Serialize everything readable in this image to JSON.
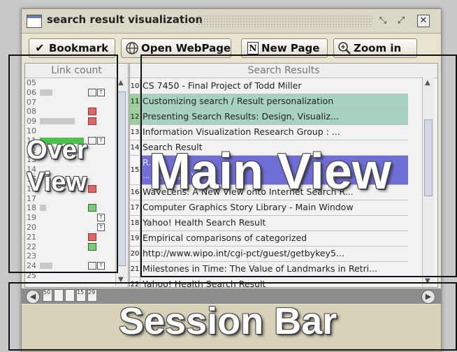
{
  "window": {
    "title": "search result visualization",
    "controls": {
      "minimize_icon": "minimize-icon",
      "maximize_icon": "maximize-icon",
      "close_label": "✕"
    }
  },
  "toolbar": {
    "bookmark_label": "Bookmark",
    "open_webpage_label": "Open WebPage",
    "new_page_label": "New Page",
    "zoom_in_label": "Zoom in",
    "new_page_icon_letter": "N"
  },
  "overview": {
    "header": "Link count",
    "rows": [
      {
        "num": "05",
        "bar": 0,
        "i1": "",
        "i2": ""
      },
      {
        "num": "06",
        "bar": 0.2,
        "i1": "grey",
        "i2": "T"
      },
      {
        "num": "07",
        "bar": 0,
        "i1": "",
        "i2": ""
      },
      {
        "num": "08",
        "bar": 0,
        "i1": "red",
        "i2": ""
      },
      {
        "num": "09",
        "bar": 0.55,
        "i1": "red",
        "i2": ""
      },
      {
        "num": "10",
        "bar": 0,
        "i1": "",
        "i2": ""
      },
      {
        "num": "11",
        "bar": 0.7,
        "i1": "grey",
        "i2": "T",
        "green": true
      },
      {
        "num": "12",
        "bar": 0,
        "i1": "",
        "i2": ""
      },
      {
        "num": "13",
        "bar": 0,
        "i1": "",
        "i2": ""
      },
      {
        "num": "14",
        "bar": 0,
        "i1": "",
        "i2": ""
      },
      {
        "num": "15",
        "bar": 0,
        "i1": "",
        "i2": ""
      },
      {
        "num": "16",
        "bar": 0,
        "i1": "red",
        "i2": ""
      },
      {
        "num": "17",
        "bar": 0,
        "i1": "",
        "i2": ""
      },
      {
        "num": "18",
        "bar": 0.1,
        "i1": "grn",
        "i2": ""
      },
      {
        "num": "19",
        "bar": 0,
        "i1": "",
        "i2": "T"
      },
      {
        "num": "20",
        "bar": 0,
        "i1": "",
        "i2": "T"
      },
      {
        "num": "21",
        "bar": 0,
        "i1": "red",
        "i2": ""
      },
      {
        "num": "22",
        "bar": 0,
        "i1": "grn",
        "i2": ""
      },
      {
        "num": "23",
        "bar": 0,
        "i1": "",
        "i2": ""
      },
      {
        "num": "24",
        "bar": 0.2,
        "i1": "grey",
        "i2": "T"
      },
      {
        "num": "25",
        "bar": 0,
        "i1": "",
        "i2": ""
      }
    ]
  },
  "results": {
    "header": "Search Results",
    "rows": [
      {
        "num": "10",
        "text": "CS 7450 - Final Project of Todd Miller",
        "style": ""
      },
      {
        "num": "11",
        "text": "Customizing search / Result personalization",
        "style": "green"
      },
      {
        "num": "12",
        "text": "Presenting Search Results: Design, Visualiz...",
        "style": "green"
      },
      {
        "num": "13",
        "text": "Information Visualization Research Group : ...",
        "style": ""
      },
      {
        "num": "14",
        "text": "Search Result",
        "style": ""
      },
      {
        "num": "15",
        "text": "R...",
        "style": "sel",
        "sub": "... R...            ...ign, V..."
      },
      {
        "num": "16",
        "text": "WaveLens: A New View onto Internet Search R...",
        "style": ""
      },
      {
        "num": "17",
        "text": "Computer Graphics Story Library - Main Window",
        "style": ""
      },
      {
        "num": "18",
        "text": "Yahoo! Health Search Result",
        "style": ""
      },
      {
        "num": "19",
        "text": "Empirical comparisons of categorized",
        "style": ""
      },
      {
        "num": "20",
        "text": "http://www.wipo.int/cgi-pct/guest/getbykey5...",
        "style": ""
      },
      {
        "num": "21",
        "text": "Milestones in Time: The Value of Landmarks in Retri...",
        "style": ""
      },
      {
        "num": "22",
        "text": "Yahoo! Health Search Result",
        "style": ""
      }
    ]
  },
  "session": {
    "docs": [
      "50",
      "",
      "",
      "15",
      "29"
    ]
  },
  "overlays": {
    "overview": "Over\nView",
    "main_view": "Main View",
    "session_bar": "Session Bar"
  }
}
